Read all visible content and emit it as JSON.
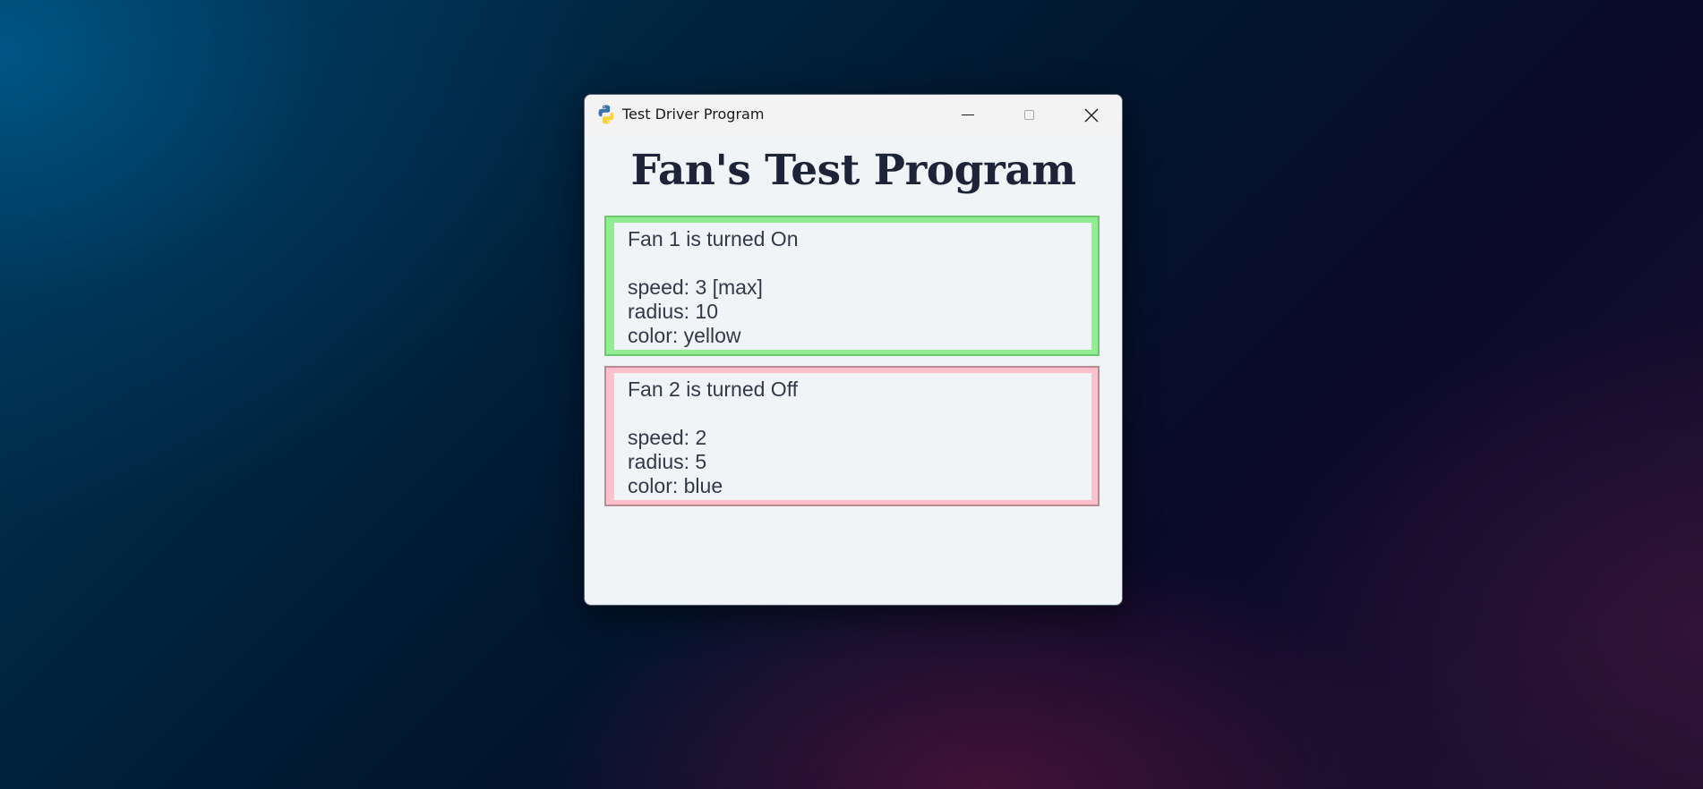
{
  "window": {
    "title": "Test Driver Program"
  },
  "heading": "Fan's Test Program",
  "fans": [
    {
      "status": "Fan 1 is turned On",
      "speed": "speed: 3 [max]",
      "radius": "radius: 10",
      "color": "color: yellow",
      "border_color": "#90ee90"
    },
    {
      "status": "Fan 2 is turned Off",
      "speed": "speed: 2",
      "radius": "radius: 5",
      "color": "color: blue",
      "border_color": "#ffc0cb"
    }
  ],
  "icons": {
    "app": "python-icon",
    "minimize": "minimize-icon",
    "maximize": "maximize-icon",
    "close": "close-icon"
  },
  "colors": {
    "window_bg": "#f0f4f7",
    "heading_text": "#1d2438",
    "body_text": "#303a48"
  }
}
